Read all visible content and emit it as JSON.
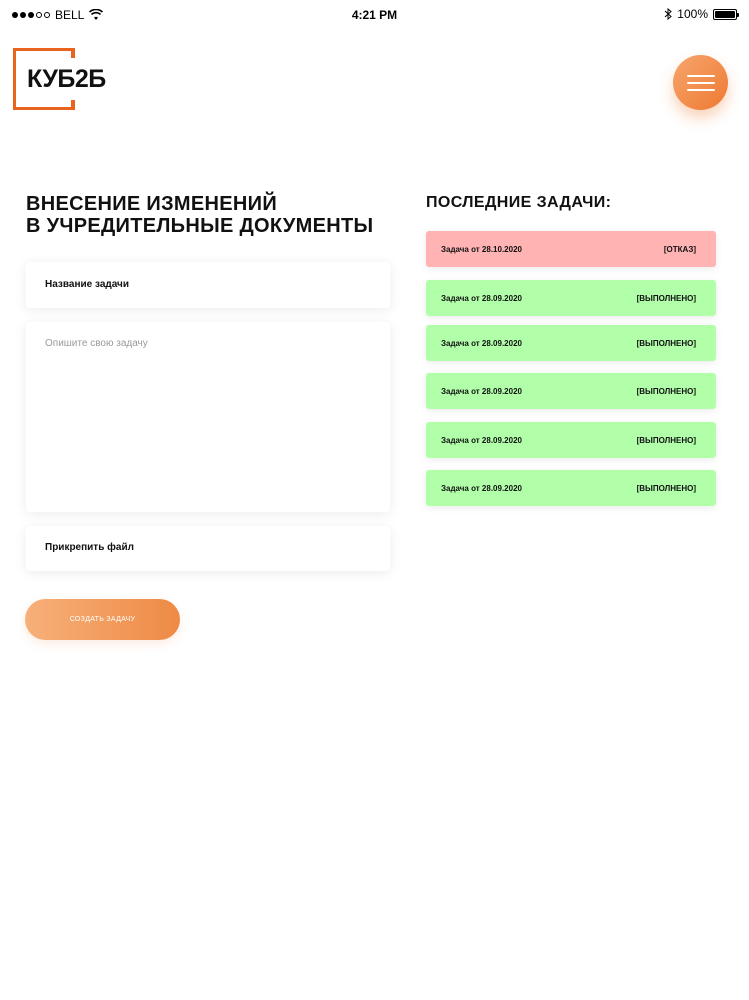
{
  "status_bar": {
    "carrier": "BELL",
    "time": "4:21 PM",
    "battery": "100%"
  },
  "header": {
    "logo_text": "КУБ2Б",
    "menu_icon": "hamburger-icon",
    "accent_color": "#e8641e"
  },
  "form": {
    "title_line1": "ВНЕСЕНИЕ ИЗМЕНЕНИЙ",
    "title_line2": "В УЧРЕДИТЕЛЬНЫЕ ДОКУМЕНТЫ",
    "task_name_label": "Название задачи",
    "description_placeholder": "Опишите свою задачу",
    "attach_label": "Прикрепить файл",
    "submit_label": "Создать задачу"
  },
  "tasks": {
    "title": "ПОСЛЕДНИЕ ЗАДАЧИ:",
    "items": [
      {
        "label": "Задача от 28.10.2020",
        "status": "[ОТКАЗ]",
        "state": "rejected",
        "color": "#ffb3b3"
      },
      {
        "label": "Задача от 28.09.2020",
        "status": "[ВЫПОЛНЕНО]",
        "state": "done",
        "color": "#b2ffa9"
      },
      {
        "label": "Задача от 28.09.2020",
        "status": "[ВЫПОЛНЕНО]",
        "state": "done",
        "color": "#b2ffa9"
      },
      {
        "label": "Задача от 28.09.2020",
        "status": "[ВЫПОЛНЕНО]",
        "state": "done",
        "color": "#b2ffa9"
      },
      {
        "label": "Задача от 28.09.2020",
        "status": "[ВЫПОЛНЕНО]",
        "state": "done",
        "color": "#b2ffa9"
      },
      {
        "label": "Задача от 28.09.2020",
        "status": "[ВЫПОЛНЕНО]",
        "state": "done",
        "color": "#b2ffa9"
      }
    ]
  }
}
